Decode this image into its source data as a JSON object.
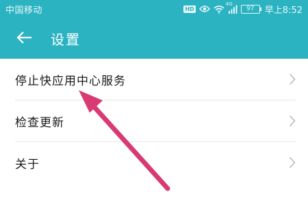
{
  "status_bar": {
    "carrier": "中国移动",
    "hd_label": "HD",
    "network_type": "4G",
    "battery": "97",
    "time": "早上8:52",
    "icons": [
      "hd-icon",
      "eye-icon",
      "wifi-icon",
      "signal-icon",
      "battery-icon"
    ]
  },
  "toolbar": {
    "back_icon": "arrow-left-icon",
    "title": "设置"
  },
  "list": {
    "items": [
      {
        "label": "停止快应用中心服务"
      },
      {
        "label": "检查更新"
      },
      {
        "label": "关于"
      }
    ],
    "chevron_icon": "chevron-right-icon"
  },
  "annotation": {
    "arrow_color": "#d83a74"
  },
  "colors": {
    "appbar": "#2bb3c2",
    "divider": "#e6e6e6",
    "chevron": "#b8b8b8"
  }
}
